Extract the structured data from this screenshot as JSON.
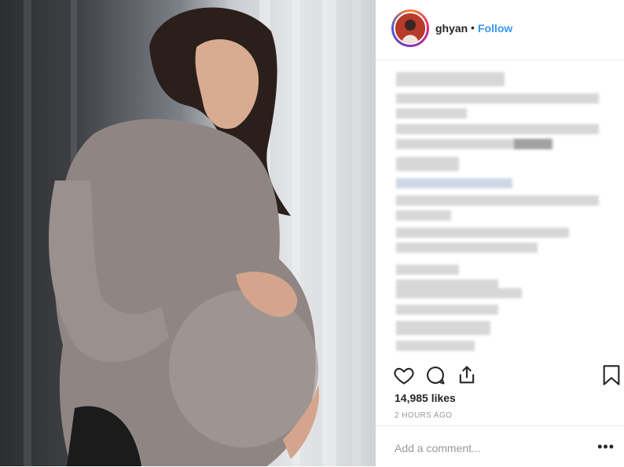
{
  "post": {
    "username": "ghyan",
    "separator": "•",
    "follow_label": "Follow",
    "likes": "14,985 likes",
    "timestamp": "2 HOURS AGO",
    "comment_placeholder": "Add a comment...",
    "more_label": "•••"
  },
  "icons": {
    "like": "heart-icon",
    "comment": "speech-bubble-icon",
    "share": "share-icon",
    "save": "bookmark-icon",
    "more": "ellipsis-icon"
  },
  "colors": {
    "follow": "#3897f0",
    "text": "#262626",
    "muted": "#999999",
    "avatar_ring": "#dd2a7b"
  }
}
